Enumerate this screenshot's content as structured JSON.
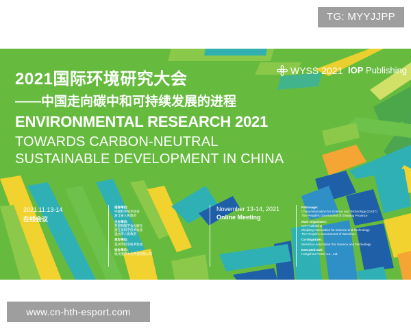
{
  "watermark": {
    "tg": "TG: MYYJJPP",
    "url": "www.cn-hth-esport.com"
  },
  "colors": {
    "banner_green": "#66bb3f",
    "accent_yellow": "#f2d22e",
    "accent_teal": "#2fb0b5",
    "accent_blue": "#1e5fa8",
    "accent_orange": "#f4a533"
  },
  "banner": {
    "title_cn": "2021国际环境研究大会",
    "subtitle_cn": "——中国走向碳中和可持续发展的进程",
    "title_en": "ENVIRONMENTAL RESEARCH 2021",
    "subtitle_en_line1": "TOWARDS CARBON-NEUTRAL",
    "subtitle_en_line2": "SUSTAINABLE DEVELOPMENT IN CHINA",
    "brand_wyss": "WYSS",
    "brand_wyss_year": "2021",
    "brand_iop_bold": "IOP",
    "brand_iop_rest": " Publishing",
    "date_cn": "2021.11.13-14",
    "mode_cn": "在线会议",
    "date_en": "November 13-14, 2021",
    "mode_en": "Online Meeting",
    "org_cn": [
      {
        "label": "指导单位:",
        "lines": [
          "中国科学技术协会",
          "浙江省人民政府"
        ]
      },
      {
        "label": "主办单位:",
        "lines": [
          "英国物理学会出版社",
          "浙江省科学技术协会",
          "温州市人民政府"
        ]
      },
      {
        "label": "承办单位:",
        "lines": [
          "温州市科学技术协会"
        ]
      },
      {
        "label": "协办单位:",
        "lines": [
          "杭州澄伊文化传播有限公司"
        ]
      }
    ],
    "org_en": [
      {
        "label": "Patronage:",
        "lines": [
          "China Association for Science and Technology (CAST)",
          "The People's Government of Zhejiang Province"
        ]
      },
      {
        "label": "Main Organizers:",
        "lines": [
          "IOP Publishing",
          "Zhejiang Association for Science and Technology",
          "The People's Government of Wenzhou"
        ]
      },
      {
        "label": "Co-Organizer:",
        "lines": [
          "Wenzhou Association for Science and Technology"
        ]
      },
      {
        "label": "Executed and:",
        "lines": [
          "Hangzhou Peinin Co., Ltd."
        ]
      }
    ]
  }
}
